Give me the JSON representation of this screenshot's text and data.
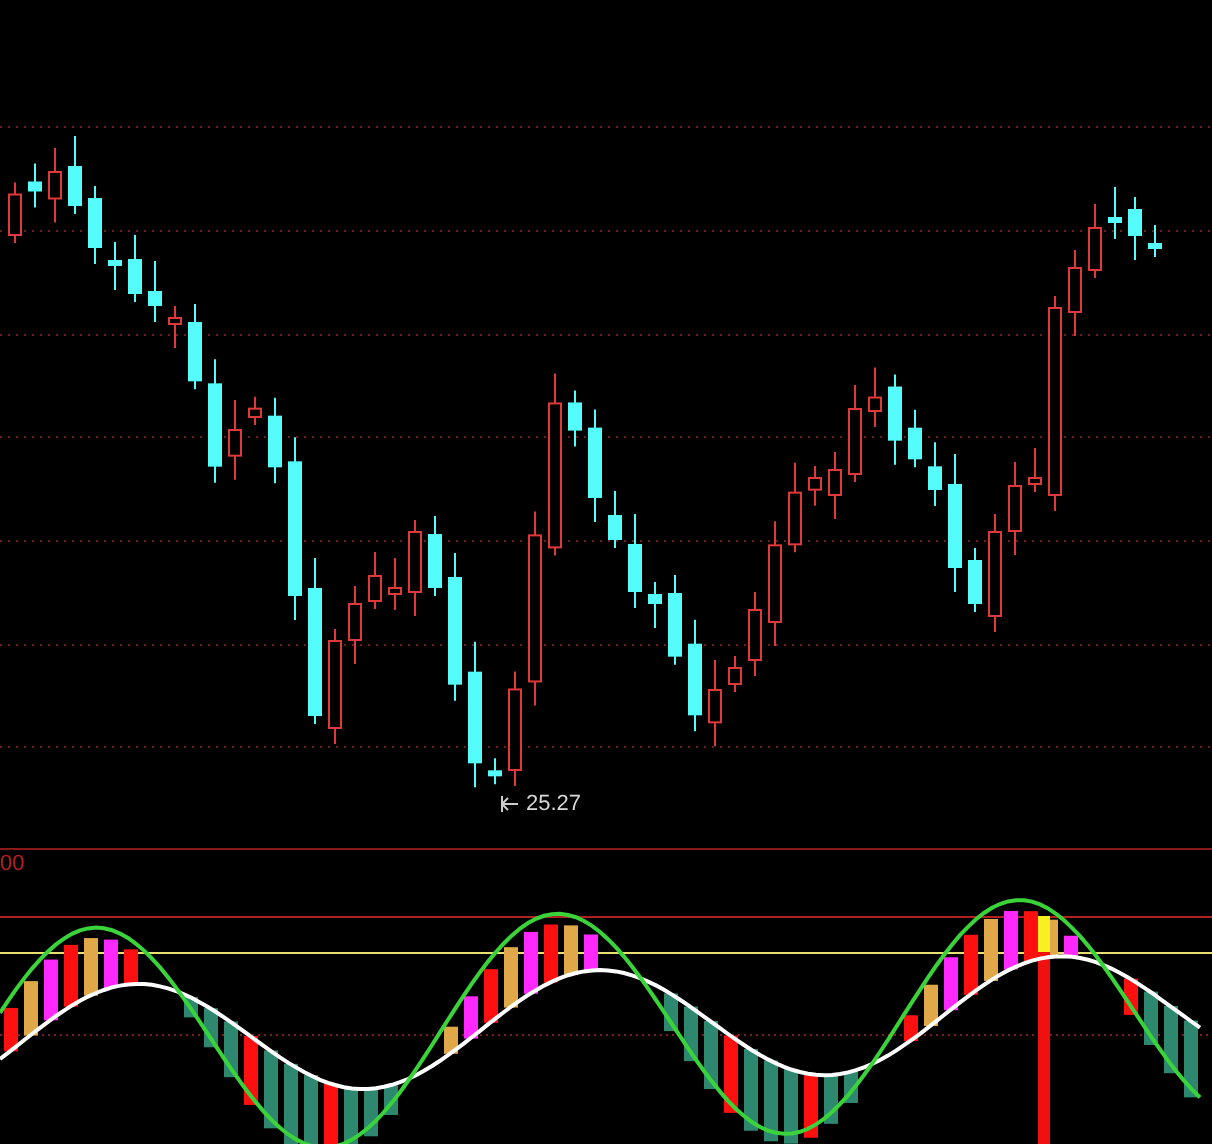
{
  "price_panel": {
    "low_label": "25.27"
  },
  "indicator_panel": {
    "scale_label": "00"
  }
}
